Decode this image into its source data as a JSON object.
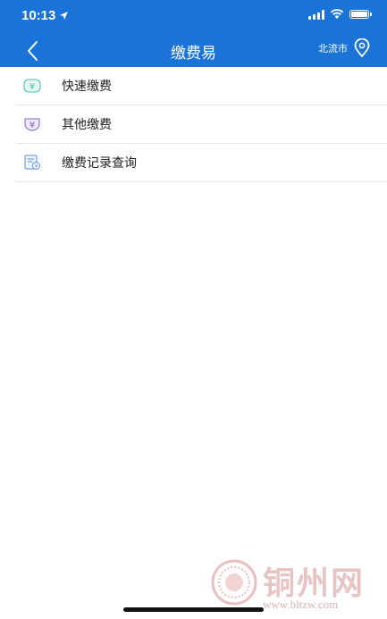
{
  "status": {
    "time": "10:13"
  },
  "header": {
    "title": "缴费易",
    "city": "北流市"
  },
  "menu": {
    "items": [
      {
        "label": "快速缴费",
        "icon": "yuan-badge-icon",
        "color": "#3cc5a8"
      },
      {
        "label": "其他缴费",
        "icon": "yuan-shield-icon",
        "color": "#7d62d6"
      },
      {
        "label": "缴费记录查询",
        "icon": "bill-record-icon",
        "color": "#5b8de6"
      }
    ]
  },
  "watermark": {
    "text": "铜州网",
    "url": "www.bltzw.com"
  },
  "colors": {
    "header_bg": "#1a73d9"
  }
}
